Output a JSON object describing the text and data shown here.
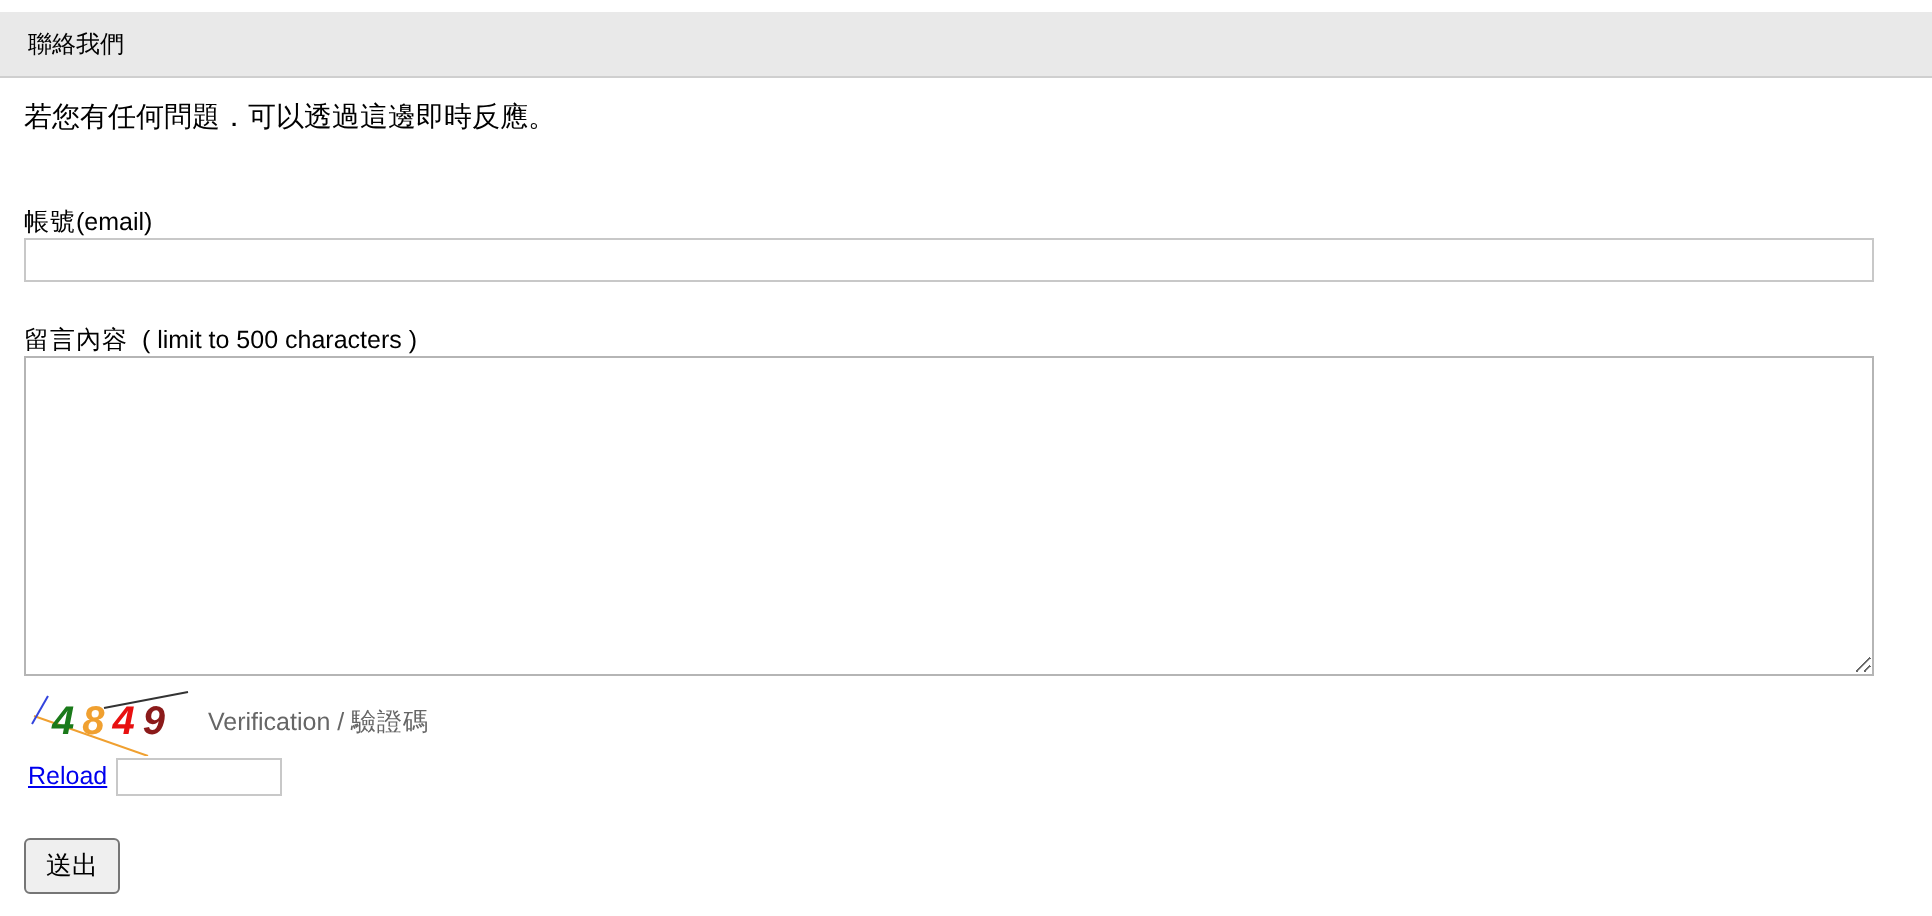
{
  "header": {
    "title": "聯絡我們"
  },
  "intro": "若您有任何問題．可以透過這邊即時反應。",
  "fields": [
    {
      "kind": "input",
      "label": "帳號(email)"
    },
    {
      "kind": "textarea",
      "label": "留言內容  ( limit to 500 characters )"
    }
  ],
  "captcha": {
    "digits": [
      {
        "text": "4",
        "color": "#1a7a1a"
      },
      {
        "text": "8",
        "color": "#f0a030"
      },
      {
        "text": "4",
        "color": "#e81010"
      },
      {
        "text": "9",
        "color": "#8b1a1a"
      }
    ],
    "label": "Verification / 驗證碼",
    "reload": "Reload"
  },
  "submit": "送出"
}
